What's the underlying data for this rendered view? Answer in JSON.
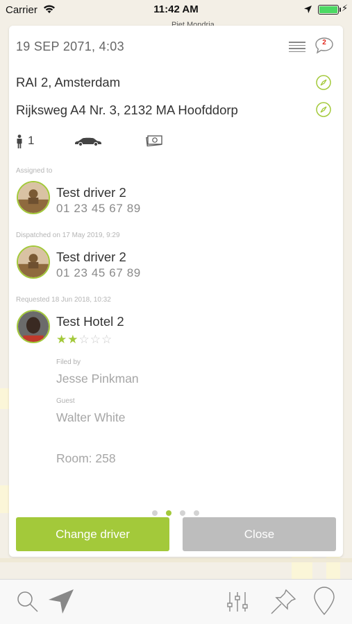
{
  "status_bar": {
    "carrier": "Carrier",
    "time": "11:42 AM",
    "battery_level": 1.0
  },
  "map": {
    "street_label": "Piet Mondria..."
  },
  "card": {
    "datetime": "19 SEP 2071, 4:03",
    "chat_badge": "2",
    "pickup_address": "RAI 2, Amsterdam",
    "dropoff_address": "Rijksweg A4 Nr. 3, 2132 MA Hoofddorp",
    "passenger_count": "1",
    "assigned_label": "Assigned to",
    "assigned_driver": {
      "name": "Test driver 2",
      "phone": "01 23 45 67 89"
    },
    "dispatched_label": "Dispatched on 17 May 2019, 9:29",
    "dispatched_driver": {
      "name": "Test driver 2",
      "phone": "01 23 45 67 89"
    },
    "requested_label": "Requested 18 Jun 2018, 10:32",
    "hotel": {
      "name": "Test Hotel 2",
      "rating": 2,
      "rating_max": 5
    },
    "filed_by_label": "Filed by",
    "filed_by_value": "Jesse Pinkman",
    "guest_label": "Guest",
    "guest_value": "Walter White",
    "room": "Room: 258",
    "pager": {
      "count": 4,
      "active": 1
    },
    "change_driver_label": "Change driver",
    "close_label": "Close"
  },
  "tab_bar": {
    "icons": [
      "search-icon",
      "navigation-arrow-icon",
      "sliders-icon",
      "pin-icon",
      "location-marker-icon"
    ]
  },
  "colors": {
    "accent": "#a3c93a",
    "close_button": "#bdbdbd",
    "badge_red": "#e0261b"
  }
}
